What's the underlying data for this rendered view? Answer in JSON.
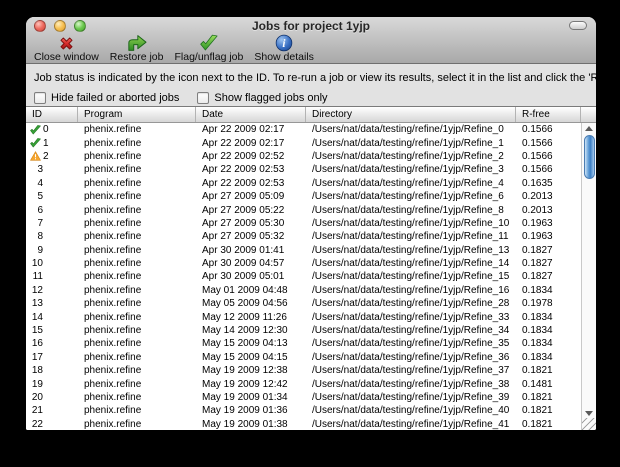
{
  "window": {
    "title": "Jobs for project 1yjp"
  },
  "toolbar": {
    "items": [
      {
        "label": "Close window",
        "icon": "close-x-icon"
      },
      {
        "label": "Restore job",
        "icon": "restore-arrow-icon"
      },
      {
        "label": "Flag/unflag job",
        "icon": "flag-check-icon"
      },
      {
        "label": "Show details",
        "icon": "info-icon"
      }
    ]
  },
  "infobar": {
    "text": "Job status is indicated by the icon next to the ID. To re-run a job or view its results, select it in the list and click the 'Restore' button."
  },
  "filters": {
    "hide_failed": {
      "label": "Hide failed or aborted jobs",
      "checked": false
    },
    "show_flagged": {
      "label": "Show flagged jobs only",
      "checked": false
    }
  },
  "table": {
    "columns": [
      "ID",
      "Program",
      "Date",
      "Directory",
      "R-free"
    ],
    "rows": [
      {
        "id": "0",
        "status": "success",
        "program": "phenix.refine",
        "date": "Apr 22 2009 02:17",
        "directory": "/Users/nat/data/testing/refine/1yjp/Refine_0",
        "rfree": "0.1566"
      },
      {
        "id": "1",
        "status": "success",
        "program": "phenix.refine",
        "date": "Apr 22 2009 02:17",
        "directory": "/Users/nat/data/testing/refine/1yjp/Refine_1",
        "rfree": "0.1566"
      },
      {
        "id": "2",
        "status": "warning",
        "program": "phenix.refine",
        "date": "Apr 22 2009 02:52",
        "directory": "/Users/nat/data/testing/refine/1yjp/Refine_2",
        "rfree": "0.1566"
      },
      {
        "id": "3",
        "status": "none",
        "program": "phenix.refine",
        "date": "Apr 22 2009 02:53",
        "directory": "/Users/nat/data/testing/refine/1yjp/Refine_3",
        "rfree": "0.1566"
      },
      {
        "id": "4",
        "status": "none",
        "program": "phenix.refine",
        "date": "Apr 22 2009 02:53",
        "directory": "/Users/nat/data/testing/refine/1yjp/Refine_4",
        "rfree": "0.1635"
      },
      {
        "id": "5",
        "status": "none",
        "program": "phenix.refine",
        "date": "Apr 27 2009 05:09",
        "directory": "/Users/nat/data/testing/refine/1yjp/Refine_6",
        "rfree": "0.2013"
      },
      {
        "id": "6",
        "status": "none",
        "program": "phenix.refine",
        "date": "Apr 27 2009 05:22",
        "directory": "/Users/nat/data/testing/refine/1yjp/Refine_8",
        "rfree": "0.2013"
      },
      {
        "id": "7",
        "status": "none",
        "program": "phenix.refine",
        "date": "Apr 27 2009 05:30",
        "directory": "/Users/nat/data/testing/refine/1yjp/Refine_10",
        "rfree": "0.1963"
      },
      {
        "id": "8",
        "status": "none",
        "program": "phenix.refine",
        "date": "Apr 27 2009 05:32",
        "directory": "/Users/nat/data/testing/refine/1yjp/Refine_11",
        "rfree": "0.1963"
      },
      {
        "id": "9",
        "status": "none",
        "program": "phenix.refine",
        "date": "Apr 30 2009 01:41",
        "directory": "/Users/nat/data/testing/refine/1yjp/Refine_13",
        "rfree": "0.1827"
      },
      {
        "id": "10",
        "status": "none",
        "program": "phenix.refine",
        "date": "Apr 30 2009 04:57",
        "directory": "/Users/nat/data/testing/refine/1yjp/Refine_14",
        "rfree": "0.1827"
      },
      {
        "id": "11",
        "status": "none",
        "program": "phenix.refine",
        "date": "Apr 30 2009 05:01",
        "directory": "/Users/nat/data/testing/refine/1yjp/Refine_15",
        "rfree": "0.1827"
      },
      {
        "id": "12",
        "status": "none",
        "program": "phenix.refine",
        "date": "May 01 2009 04:48",
        "directory": "/Users/nat/data/testing/refine/1yjp/Refine_16",
        "rfree": "0.1834"
      },
      {
        "id": "13",
        "status": "none",
        "program": "phenix.refine",
        "date": "May 05 2009 04:56",
        "directory": "/Users/nat/data/testing/refine/1yjp/Refine_28",
        "rfree": "0.1978"
      },
      {
        "id": "14",
        "status": "none",
        "program": "phenix.refine",
        "date": "May 12 2009 11:26",
        "directory": "/Users/nat/data/testing/refine/1yjp/Refine_33",
        "rfree": "0.1834"
      },
      {
        "id": "15",
        "status": "none",
        "program": "phenix.refine",
        "date": "May 14 2009 12:30",
        "directory": "/Users/nat/data/testing/refine/1yjp/Refine_34",
        "rfree": "0.1834"
      },
      {
        "id": "16",
        "status": "none",
        "program": "phenix.refine",
        "date": "May 15 2009 04:13",
        "directory": "/Users/nat/data/testing/refine/1yjp/Refine_35",
        "rfree": "0.1834"
      },
      {
        "id": "17",
        "status": "none",
        "program": "phenix.refine",
        "date": "May 15 2009 04:15",
        "directory": "/Users/nat/data/testing/refine/1yjp/Refine_36",
        "rfree": "0.1834"
      },
      {
        "id": "18",
        "status": "none",
        "program": "phenix.refine",
        "date": "May 19 2009 12:38",
        "directory": "/Users/nat/data/testing/refine/1yjp/Refine_37",
        "rfree": "0.1821"
      },
      {
        "id": "19",
        "status": "none",
        "program": "phenix.refine",
        "date": "May 19 2009 12:42",
        "directory": "/Users/nat/data/testing/refine/1yjp/Refine_38",
        "rfree": "0.1481"
      },
      {
        "id": "20",
        "status": "none",
        "program": "phenix.refine",
        "date": "May 19 2009 01:34",
        "directory": "/Users/nat/data/testing/refine/1yjp/Refine_39",
        "rfree": "0.1821"
      },
      {
        "id": "21",
        "status": "none",
        "program": "phenix.refine",
        "date": "May 19 2009 01:36",
        "directory": "/Users/nat/data/testing/refine/1yjp/Refine_40",
        "rfree": "0.1821"
      },
      {
        "id": "22",
        "status": "none",
        "program": "phenix.refine",
        "date": "May 19 2009 01:38",
        "directory": "/Users/nat/data/testing/refine/1yjp/Refine_41",
        "rfree": "0.1821"
      }
    ]
  },
  "colors": {
    "success_green": "#36a336",
    "warning_orange": "#f6a62f",
    "close_red": "#c92121",
    "info_blue": "#2b62b5",
    "scrollbar_thumb_blue": "#3c7fc6"
  }
}
